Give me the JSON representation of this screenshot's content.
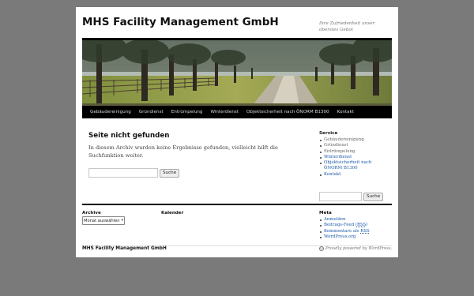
{
  "site": {
    "title": "MHS Facility Management GmbH",
    "description": "Ihre Zufriedenheit unser oberstes Gebot"
  },
  "nav": {
    "items": [
      {
        "label": "Gebäudereinigung"
      },
      {
        "label": "Gründienst"
      },
      {
        "label": "Entrümpelung"
      },
      {
        "label": "Winterdienst"
      },
      {
        "label": "Objektsicherheit nach ÖNORM B1300"
      },
      {
        "label": "Kontakt"
      }
    ]
  },
  "main": {
    "title": "Seite nicht gefunden",
    "message": "In diesem Archiv wurden keine Ergebnisse gefunden, vielleicht hilft die Suchfunktion weiter.",
    "search": {
      "value": "",
      "button": "Suche"
    }
  },
  "sidebar": {
    "service_title": "Service",
    "service_items": [
      {
        "label": "Gebäudereinigung"
      },
      {
        "label": "Gründienst"
      },
      {
        "label": "Entrümpelung"
      },
      {
        "label": "Winterdienst"
      },
      {
        "label": "Objektsicherheit nach ÖNORM B1300"
      },
      {
        "label": "Kontakt"
      }
    ],
    "search": {
      "value": "",
      "button": "Suche"
    }
  },
  "footer_widgets": {
    "archive_title": "Archive",
    "archive_select": "Monat auswählen",
    "calendar_title": "Kalender",
    "meta_title": "Meta",
    "meta_items": [
      {
        "label": "Anmelden"
      },
      {
        "label_prefix": "Beitrags-Feed (",
        "abbr": "RSS",
        "label_suffix": ")"
      },
      {
        "label_prefix": "Kommentare als ",
        "abbr": "RSS",
        "label_suffix": ""
      },
      {
        "label": "WordPress.org"
      }
    ]
  },
  "footer": {
    "site_title": "MHS Facility Management GmbH",
    "powered": "Proudly powered by WordPress."
  },
  "colors": {
    "page_background": "#7a7a7a",
    "nav_background": "#000000",
    "link": "#1b5aa8"
  },
  "icons": {
    "select_arrow": "chevron-down-icon",
    "wordpress": "wordpress-icon"
  }
}
